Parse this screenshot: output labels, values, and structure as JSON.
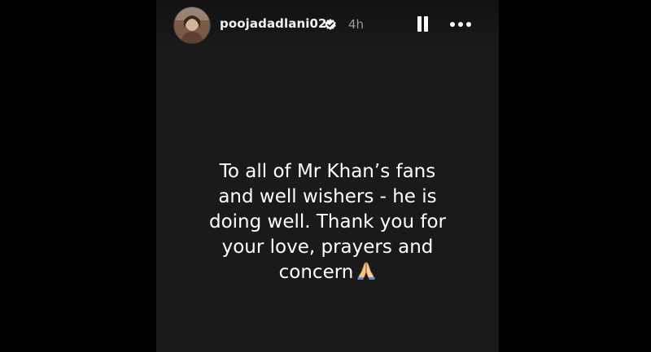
{
  "story": {
    "username": "poojadadlani02",
    "time_ago": "4h",
    "verified": true,
    "text": "To all of Mr Khan’s fans\nand well wishers - he is\ndoing well. Thank you for\nyour love, prayers and\nconcern",
    "emoji": "folded-hands-icon"
  },
  "colors": {
    "page_background": "#000000",
    "story_background": "#1a1a1a",
    "text": "#ffffff",
    "muted_text": "#9a9a9a",
    "verified_badge": "#ffffff"
  }
}
